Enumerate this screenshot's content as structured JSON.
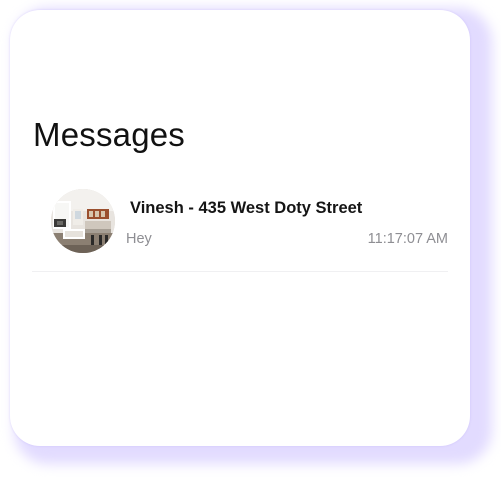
{
  "header": {
    "title": "Messages"
  },
  "conversations": [
    {
      "name": "Vinesh - 435 West Doty Street",
      "preview": "Hey",
      "time": "11:17:07 AM",
      "avatar": "property-interior-photo"
    }
  ],
  "colors": {
    "accent_glow": "#e2dbff",
    "card_background": "#ffffff",
    "primary_text": "#151515",
    "secondary_text": "#8e8e93",
    "divider": "#f0f0f2"
  }
}
